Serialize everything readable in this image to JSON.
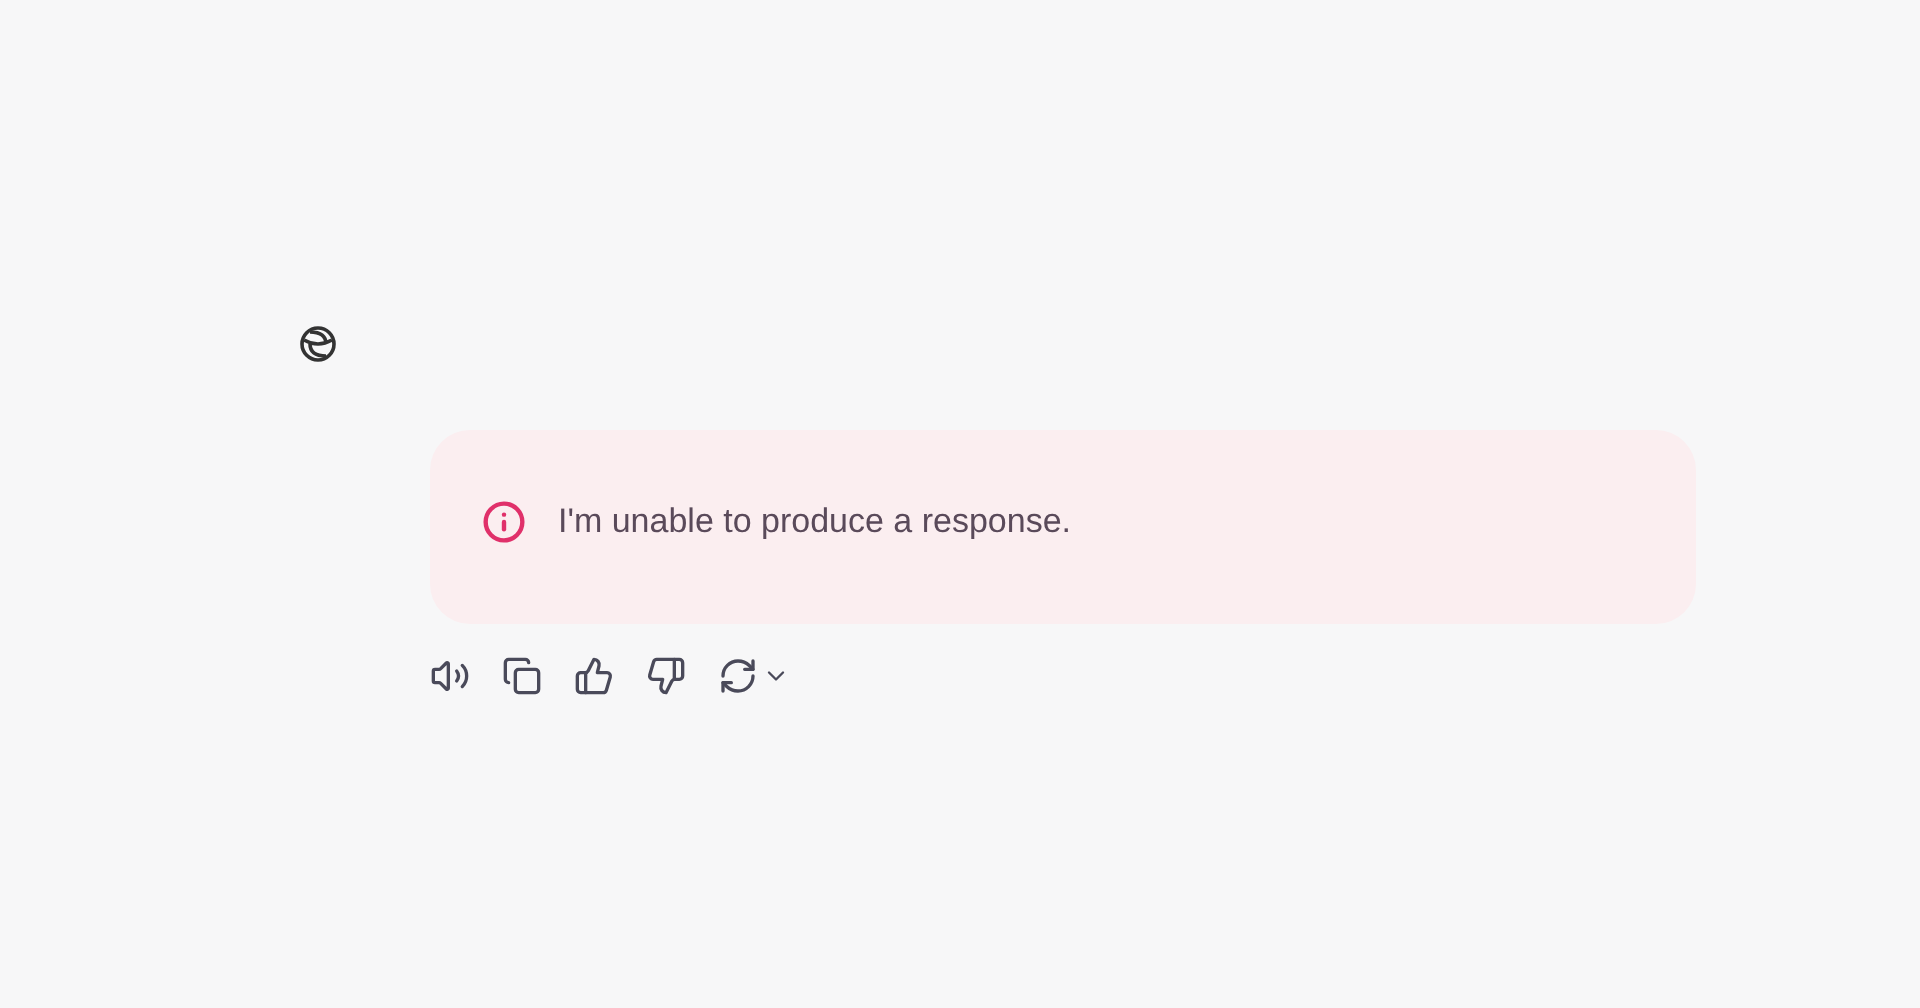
{
  "message": {
    "kind": "error",
    "text": "I'm unable to produce a response."
  }
}
